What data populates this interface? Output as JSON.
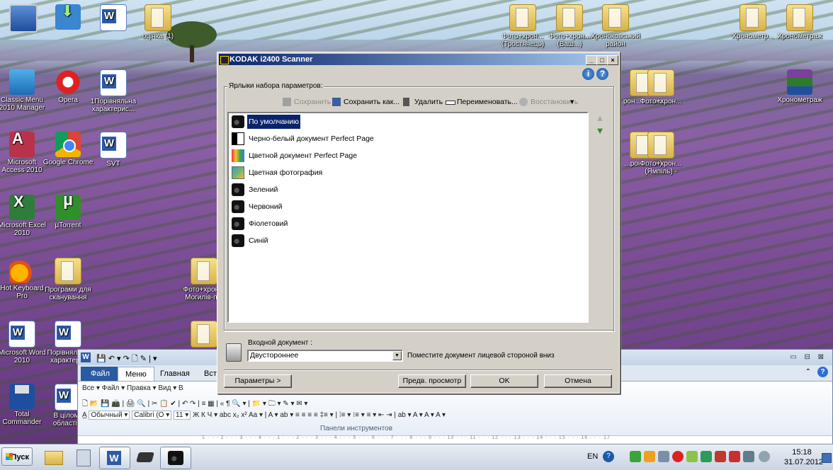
{
  "desktop": {
    "icons": [
      {
        "label": ""
      },
      {
        "label": ""
      },
      {
        "label": ""
      },
      {
        "label": "оцінка (1)"
      },
      {
        "label": "Classic Menu 2010 Manager"
      },
      {
        "label": "Opera"
      },
      {
        "label": "1Порівняльна характерис..."
      },
      {
        "label": "Microsoft Access 2010"
      },
      {
        "label": "Google Chrome"
      },
      {
        "label": "SVT"
      },
      {
        "label": "Microsoft Excel 2010"
      },
      {
        "label": "µTorrent"
      },
      {
        "label": "Hot Keyboard Pro"
      },
      {
        "label": "Програми для сканування"
      },
      {
        "label": "Microsoft Word 2010"
      },
      {
        "label": "Порівняльна характер..."
      },
      {
        "label": "Total Commander"
      },
      {
        "label": "В цілому області б"
      },
      {
        "label": "Фото+хрон... (Тростянець)"
      },
      {
        "label": "Фото+хрон... (Ваш...)"
      },
      {
        "label": "Хроноковський район"
      },
      {
        "label": "Хронометр..."
      },
      {
        "label": "Хронометраж"
      },
      {
        "label": "Хронометраж"
      },
      {
        "label": "Фото+хрон... Могилів-п..."
      },
      {
        "label": "...рон... ...ськи..."
      },
      {
        "label": "Фото+хрон..."
      },
      {
        "label": "...рон... ...н)"
      },
      {
        "label": "Фото+хрон... (Ямпіль) -"
      }
    ]
  },
  "dialog": {
    "title": "KODAK i2400 Scanner",
    "controls": {
      "minimize": "_",
      "maximize": "□",
      "close": "×"
    },
    "help": {
      "info": "i",
      "help": "?"
    },
    "group_label": "Ярлыки набора параметров:",
    "toolbar": {
      "save": "Сохранить",
      "save_as": "Сохранить как...",
      "delete": "Удалить",
      "rename": "Переименовать...",
      "restore": "Восстановить",
      "more": "▾"
    },
    "shortcuts": [
      {
        "label": "По умолчанию",
        "icon": "black-scanner-icon"
      },
      {
        "label": "Черно-белый документ Perfect Page",
        "icon": "bw-document-icon"
      },
      {
        "label": "Цветной документ Perfect Page",
        "icon": "color-document-icon"
      },
      {
        "label": "Цветная фотография",
        "icon": "color-photo-icon"
      },
      {
        "label": "Зелений",
        "icon": "black-scanner-icon"
      },
      {
        "label": "Червоний",
        "icon": "black-scanner-icon"
      },
      {
        "label": "Фіолетовий",
        "icon": "black-scanner-icon"
      },
      {
        "label": "Синій",
        "icon": "black-scanner-icon"
      }
    ],
    "selected_index": 0,
    "arrows": {
      "up": "▲",
      "down": "▼"
    },
    "input_label": "Входной документ :",
    "input_value": "Двустороннее",
    "input_arrow": "▼",
    "hint": "Поместите документ лицевой стороной вниз",
    "buttons": {
      "params": "Параметры >",
      "preview": "Предв. просмотр",
      "ok": "OK",
      "cancel": "Отмена"
    }
  },
  "word": {
    "window_controls": "▭ ⊟ ⊠",
    "tabs": {
      "file": "Файл",
      "menu": "Меню",
      "home": "Главная",
      "insert": "Вста"
    },
    "row1": "Все ▾   Файл ▾   Правка ▾   Вид ▾   В",
    "row3_style": "Обычный ▾",
    "row3_font": "Calibri (О ▾",
    "row3_size": "11 ▾",
    "row3_rest": "Ж  К  Ч ▾  abc  x₂  x²  Aa ▾  |  A ▾  ab ▾  ≡  ≡  ≡  ≡  ‡≡ ▾  |  ⁞≡ ▾  ⁝≡ ▾  ≡ ▾  ⇤  ⇥  |  ab ▾  A ▾  A ▾  A ▾",
    "panel_label": "Панели инструментов",
    "ruler": "1 · · · 2 · · · 3 · · · 4 · · · 1 · · · 2 · · · 3 · · · 4 · · · 5 · · · 6 · · · 7 · · · 8 · · · 9 · · · 10 · · · 11 · · · 12 · · · 13 · · · 14 · · · 15 · · · 16 · · · 17"
  },
  "taskbar": {
    "start_label": "Пуск",
    "language": "EN",
    "time": "15:18",
    "date": "31.07.2012"
  }
}
